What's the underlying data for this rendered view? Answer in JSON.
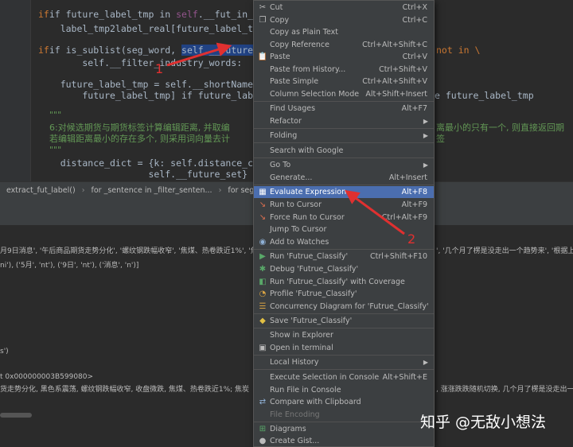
{
  "editor": {
    "line1": {
      "a": "if future_label_tmp in ",
      "self": "self",
      "b": ".__fut_in_shor"
    },
    "line2": "    label_tmp2label_real[future_label_tmp",
    "line3": {
      "a": "if is_sublist(seg_word, ",
      "sel": "self.__future_set",
      "b": "",
      "tail": "not in \\"
    },
    "line4": "        self.__filter_industry_words:",
    "line5": "    future_label_tmp = self.__shortName_D",
    "line6": {
      "a": "        future_label_tmp] if future_label",
      "tail": "e future_label_tmp"
    },
    "line7": "    \"\"\"",
    "line8": {
      "a": "    6:对候选期货与期货标签计算编辑距离, 并取编",
      "tail": "离最小的只有一个, 则直接返回期"
    },
    "line9": {
      "a": "    若编辑距离最小的存在多个, 则采用词向量去计",
      "tail": "签"
    },
    "line10": "    \"\"\"",
    "line11": "    distance_dict = {k: self.distance_cum",
    "line12": "                    self.__future_set}"
  },
  "breadcrumb": {
    "items": [
      "extract_fut_label()",
      "for _sentence in _filter_senten...",
      "for seg_tuple in"
    ]
  },
  "console": {
    "line1": "月9日消息', '午后商品期货走势分化', '螺纹钢跌幅收窄', '焦煤、热卷跌近1%', '焦炭",
    "line1_tail": "', '几个月了楞是没走出一个趋势来', '根据上期",
    "line2": "ni'), ('5月', 'nt'), ('9日', 'nt'), ('消息', 'n')]",
    "line3": "s')",
    "line4": "t 0x000000003B599080>",
    "line5": "货走势分化, 黑色系震荡, 螺纹钢跌幅收窄, 收盘微跌, 焦煤、热卷跌近1%; 焦炭",
    "line5_tail": ", 涨涨跌跌随机切换, 几个月了楞是没走出一"
  },
  "menu": {
    "items": [
      {
        "label": "Cut",
        "shortcut": "Ctrl+X",
        "icon": "scissors-icon"
      },
      {
        "label": "Copy",
        "shortcut": "Ctrl+C",
        "icon": "copy-icon"
      },
      {
        "label": "Copy as Plain Text",
        "shortcut": ""
      },
      {
        "label": "Copy Reference",
        "shortcut": "Ctrl+Alt+Shift+C"
      },
      {
        "label": "Paste",
        "shortcut": "Ctrl+V",
        "icon": "paste-icon"
      },
      {
        "label": "Paste from History...",
        "shortcut": "Ctrl+Shift+V"
      },
      {
        "label": "Paste Simple",
        "shortcut": "Ctrl+Alt+Shift+V"
      },
      {
        "label": "Column Selection Mode",
        "shortcut": "Alt+Shift+Insert"
      },
      {
        "label": "Find Usages",
        "shortcut": "Alt+F7"
      },
      {
        "label": "Refactor",
        "shortcut": ""
      },
      {
        "label": "Folding",
        "shortcut": ""
      },
      {
        "label": "Search with Google",
        "shortcut": ""
      },
      {
        "label": "Go To",
        "shortcut": ""
      },
      {
        "label": "Generate...",
        "shortcut": "Alt+Insert"
      },
      {
        "label": "Evaluate Expression...",
        "shortcut": "Alt+F8",
        "icon": "calculator-icon"
      },
      {
        "label": "Run to Cursor",
        "shortcut": "Alt+F9",
        "icon": "run-to-cursor-icon"
      },
      {
        "label": "Force Run to Cursor",
        "shortcut": "Ctrl+Alt+F9",
        "icon": "force-run-to-cursor-icon"
      },
      {
        "label": "Jump To Cursor",
        "shortcut": ""
      },
      {
        "label": "Add to Watches",
        "shortcut": "",
        "icon": "watch-icon"
      },
      {
        "label": "Run 'Futrue_Classify'",
        "shortcut": "Ctrl+Shift+F10",
        "icon": "run-icon"
      },
      {
        "label": "Debug 'Futrue_Classify'",
        "shortcut": "",
        "icon": "debug-icon"
      },
      {
        "label": "Run 'Futrue_Classify' with Coverage",
        "shortcut": "",
        "icon": "coverage-icon"
      },
      {
        "label": "Profile 'Futrue_Classify'",
        "shortcut": "",
        "icon": "profile-icon"
      },
      {
        "label": "Concurrency Diagram for 'Futrue_Classify'",
        "shortcut": "",
        "icon": "concurrency-icon"
      },
      {
        "label": "Save 'Futrue_Classify'",
        "shortcut": "",
        "icon": "python-icon"
      },
      {
        "label": "Show in Explorer",
        "shortcut": ""
      },
      {
        "label": "Open in terminal",
        "shortcut": "",
        "icon": "terminal-icon"
      },
      {
        "label": "Local History",
        "shortcut": ""
      },
      {
        "label": "Execute Selection in Console",
        "shortcut": "Alt+Shift+E"
      },
      {
        "label": "Run File in Console",
        "shortcut": ""
      },
      {
        "label": "Compare with Clipboard",
        "shortcut": "",
        "icon": "compare-icon"
      },
      {
        "label": "File Encoding",
        "shortcut": ""
      },
      {
        "label": "Diagrams",
        "shortcut": "",
        "icon": "diagram-icon"
      },
      {
        "label": "Create Gist...",
        "shortcut": "",
        "icon": "gist-icon"
      }
    ]
  },
  "annotations": {
    "marker1": "1",
    "marker2": "2",
    "color": "#e03030"
  },
  "watermark": "知乎 @无敌小想法",
  "colors": {
    "selected": "#4b6eaf",
    "menu_bg": "#3c3f41",
    "editor_bg": "#2b2b2b"
  }
}
